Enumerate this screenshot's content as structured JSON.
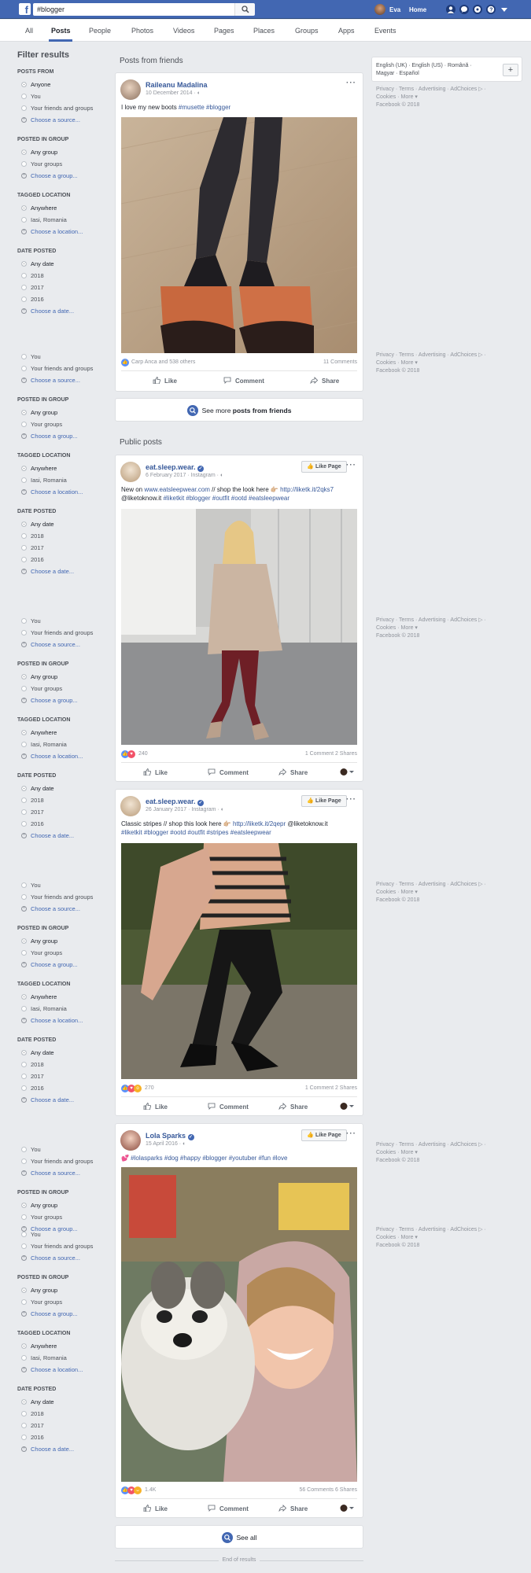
{
  "topbar": {
    "logo": "f",
    "search_value": "#blogger",
    "user_name": "Eva",
    "home_label": "Home"
  },
  "tabs": [
    "All",
    "Posts",
    "People",
    "Photos",
    "Videos",
    "Pages",
    "Places",
    "Groups",
    "Apps",
    "Events"
  ],
  "filter": {
    "title": "Filter results",
    "posts_from": {
      "heading": "POSTS FROM",
      "options": [
        "Anyone",
        "You",
        "Your friends and groups"
      ],
      "choose": "Choose a source..."
    },
    "posted_in_group": {
      "heading": "POSTED IN GROUP",
      "options": [
        "Any group",
        "Your groups"
      ],
      "choose": "Choose a group..."
    },
    "tagged_location": {
      "heading": "TAGGED LOCATION",
      "options": [
        "Anywhere",
        "Iasi, Romania"
      ],
      "choose": "Choose a location..."
    },
    "date_posted": {
      "heading": "DATE POSTED",
      "options": [
        "Any date",
        "2018",
        "2017",
        "2016"
      ],
      "choose": "Choose a date..."
    }
  },
  "sections": {
    "friends_title": "Posts from friends",
    "public_title": "Public posts",
    "see_more_prefix": "See more ",
    "see_more_bold": "posts from friends",
    "see_all": "See all",
    "end": "End of results"
  },
  "posts": [
    {
      "author": "Raileanu Madalina",
      "meta": "10 December 2014 · ",
      "text_plain": "I love my new boots ",
      "hashtags": "#musette #blogger",
      "reactions": "Carp Anca and 538 others",
      "counts": "11 Comments",
      "actions": [
        "Like",
        "Comment",
        "Share"
      ]
    },
    {
      "author": "eat.sleep.wear.",
      "meta": "6 February 2017 · Instagram · ",
      "line1_a": "New on ",
      "line1_link": "www.eatsleepwear.com",
      "line1_b": " // shop the look here 👉🏼 ",
      "line1_link2": "http://liketk.it/2qks7",
      "line2_a": "@liketoknow.it ",
      "line2_tags": "#liketkit #blogger #outfit #ootd #eatsleepwear",
      "reactions": "240",
      "counts": "1 Comment  2 Shares",
      "like_page": "Like Page",
      "actions": [
        "Like",
        "Comment",
        "Share"
      ]
    },
    {
      "author": "eat.sleep.wear.",
      "meta": "26 January 2017 · Instagram · ",
      "line1_a": "Classic stripes // shop this look here 👉🏼 ",
      "line1_link": "http://liketk.it/2qepr",
      "line1_b": " @liketoknow.it",
      "line2_tags": "#liketkit #blogger #ootd #outfit #stripes #eatsleepwear",
      "reactions": "270",
      "counts": "1 Comment  2 Shares",
      "like_page": "Like Page",
      "actions": [
        "Like",
        "Comment",
        "Share"
      ]
    },
    {
      "author": "Lola Sparks",
      "meta": "15 April 2016 · ",
      "line1_tags": "💕 #lolasparks #dog #happy #blogger #youtuber #fun #love",
      "reactions": "1.4K",
      "counts": "56 Comments  6 Shares",
      "like_page": "Like Page",
      "actions": [
        "Like",
        "Comment",
        "Share"
      ]
    }
  ],
  "right": {
    "lang_line1": "English (UK) · English (US) · Română ·",
    "lang_line2": "Magyar · Español",
    "footer1": "Privacy · Terms · Advertising · AdChoices ▷ ·",
    "footer2": "Cookies · More ▾",
    "footer3": "Facebook © 2018"
  },
  "colors": {
    "brand": "#4267b2",
    "link": "#365899",
    "background": "#e9ebee"
  }
}
